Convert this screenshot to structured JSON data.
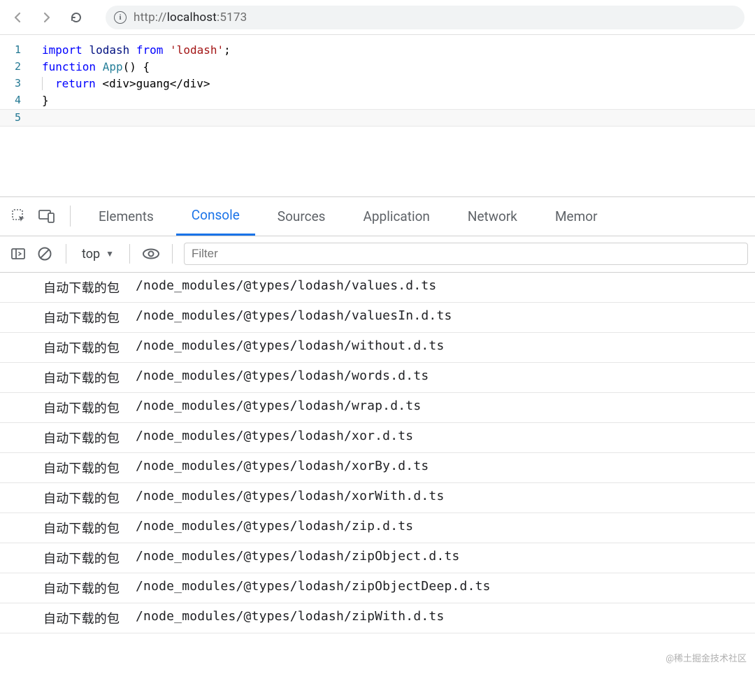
{
  "url": {
    "protocol": "http://",
    "host": "localhost",
    "port": ":5173"
  },
  "code": {
    "lines": [
      "1",
      "2",
      "3",
      "4",
      "5"
    ],
    "l1": {
      "kw1": "import",
      "id": "lodash",
      "kw2": "from",
      "str": "'lodash'",
      "semi": ";"
    },
    "l2": {
      "kw": "function",
      "fn": "App",
      "rest": "() {"
    },
    "l3": {
      "kw": "return",
      "rest": " <div>guang</div>"
    },
    "l4": {
      "brace": "}"
    }
  },
  "devtools": {
    "tabs": {
      "elements": "Elements",
      "console": "Console",
      "sources": "Sources",
      "application": "Application",
      "network": "Network",
      "memory": "Memor"
    },
    "context": "top",
    "filterPlaceholder": "Filter"
  },
  "console": {
    "prefix": "自动下载的包",
    "paths": [
      "/node_modules/@types/lodash/values.d.ts",
      "/node_modules/@types/lodash/valuesIn.d.ts",
      "/node_modules/@types/lodash/without.d.ts",
      "/node_modules/@types/lodash/words.d.ts",
      "/node_modules/@types/lodash/wrap.d.ts",
      "/node_modules/@types/lodash/xor.d.ts",
      "/node_modules/@types/lodash/xorBy.d.ts",
      "/node_modules/@types/lodash/xorWith.d.ts",
      "/node_modules/@types/lodash/zip.d.ts",
      "/node_modules/@types/lodash/zipObject.d.ts",
      "/node_modules/@types/lodash/zipObjectDeep.d.ts",
      "/node_modules/@types/lodash/zipWith.d.ts"
    ]
  },
  "watermark": "@稀土掘金技术社区"
}
